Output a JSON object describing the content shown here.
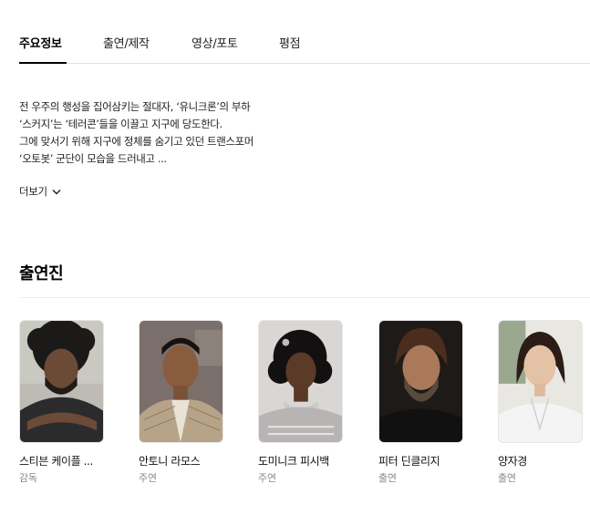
{
  "tabs": [
    {
      "label": "주요정보",
      "active": true
    },
    {
      "label": "출연/제작",
      "active": false
    },
    {
      "label": "영상/포토",
      "active": false
    },
    {
      "label": "평점",
      "active": false
    }
  ],
  "synopsis": {
    "lines": [
      "전 우주의 행성을 집어삼키는 절대자, ‘유니크론’의 부하",
      "‘스커지’는 ‘테러콘’들을 이끌고 지구에 당도한다.",
      "그에 맞서기 위해 지구에 정체를 숨기고 있던 트랜스포머",
      "‘오토봇’ 군단이 모습을 드러내고 ..."
    ],
    "more_label": "더보기",
    "more_icon": "chevron-down-icon"
  },
  "cast_section": {
    "title": "출연진",
    "members": [
      {
        "name": "스티븐 케이플 ...",
        "role": "감독"
      },
      {
        "name": "안토니 라모스",
        "role": "주연"
      },
      {
        "name": "도미니크 피시백",
        "role": "주연"
      },
      {
        "name": "피터 딘클리지",
        "role": "출연"
      },
      {
        "name": "양자경",
        "role": "출연"
      }
    ]
  },
  "colors": {
    "text": "#111111",
    "subtext": "#8a8a8a",
    "divider": "#e2e2e2",
    "active_underline": "#000000"
  }
}
